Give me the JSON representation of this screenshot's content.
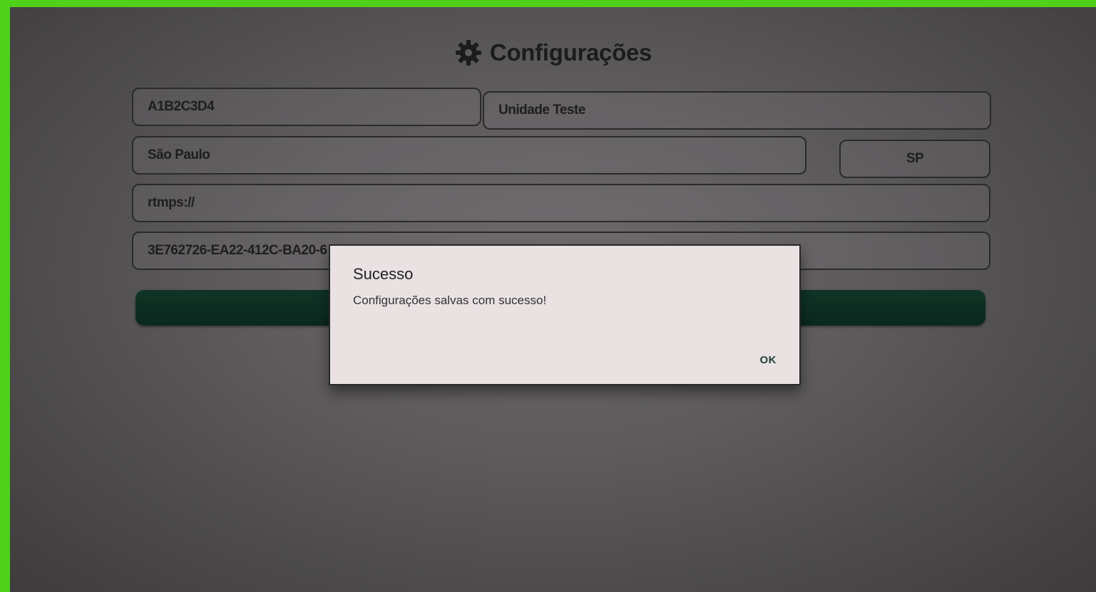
{
  "screen": {
    "title": "Configurações",
    "title_icon": "gear-icon"
  },
  "form": {
    "code": "A1B2C3D4",
    "unit_name": "Unidade Teste",
    "city": "São Paulo",
    "state": "SP",
    "stream_url": "rtmps://",
    "device_key": "3E762726-EA22-412C-BA20-6"
  },
  "dialog": {
    "title": "Sucesso",
    "message": "Configurações salvas com sucesso!",
    "ok_label": "OK"
  },
  "colors": {
    "border_green": "#4fd11a",
    "save_button": "#0f3526",
    "dialog_bg": "#e9e1e2",
    "ok_text": "#1f3f3a"
  }
}
